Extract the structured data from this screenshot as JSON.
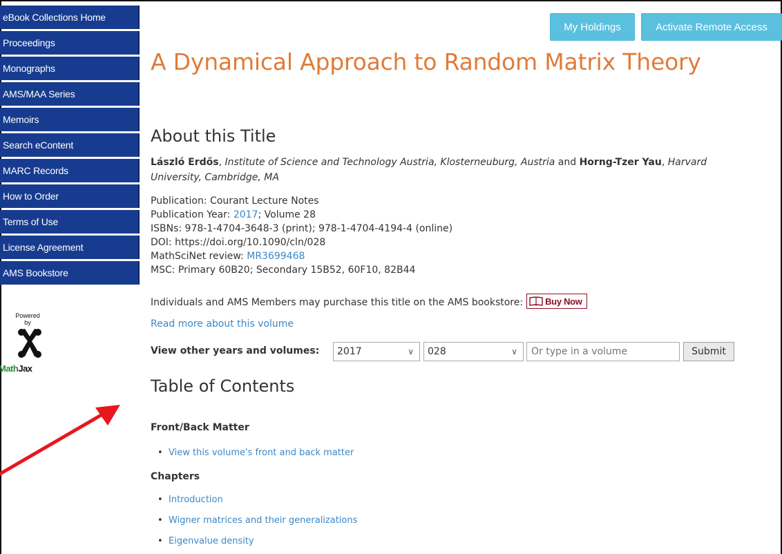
{
  "sidebar": {
    "items": [
      {
        "label": "eBook Collections Home"
      },
      {
        "label": "Proceedings"
      },
      {
        "label": "Monographs"
      },
      {
        "label": "AMS/MAA Series"
      },
      {
        "label": "Memoirs"
      },
      {
        "label": "Search eContent"
      },
      {
        "label": "MARC Records"
      },
      {
        "label": "How to Order"
      },
      {
        "label": "Terms of Use"
      },
      {
        "label": "License Agreement"
      },
      {
        "label": "AMS Bookstore"
      }
    ],
    "powered_by": "Powered\nby",
    "mathjax_math": "Math",
    "mathjax_jax": "Jax"
  },
  "header": {
    "my_holdings": "My Holdings",
    "activate_remote_access": "Activate Remote Access"
  },
  "book": {
    "title": "A Dynamical Approach to Random Matrix Theory",
    "about_heading": "About this Title",
    "author1": "László Erdős",
    "author1_affil": "Institute of Science and Technology Austria, Klosterneuburg, Austria",
    "and": " and ",
    "author2": "Horng-Tzer Yau",
    "author2_affil_line1": "Harvard",
    "author2_affil_line2": "University, Cambridge, MA",
    "publication": "Publication: Courant Lecture Notes",
    "pub_year_prefix": "Publication Year: ",
    "pub_year": "2017",
    "pub_volume": "; Volume 28",
    "isbns": "ISBNs: 978-1-4704-3648-3 (print); 978-1-4704-4194-4 (online)",
    "doi": "DOI: https://doi.org/10.1090/cln/028",
    "mathscinet_prefix": "MathSciNet review: ",
    "mathscinet": "MR3699468",
    "msc": "MSC: Primary 60B20; Secondary 15B52, 60F10, 82B44",
    "purchase_text": "Individuals and AMS Members may purchase this title on the AMS bookstore:",
    "buy_now": "Buy Now",
    "read_more": "Read more about this volume"
  },
  "volume_selector": {
    "label": "View other years and volumes:",
    "year": "2017",
    "volume": "028",
    "placeholder": "Or type in a volume",
    "submit": "Submit"
  },
  "toc": {
    "heading": "Table of Contents",
    "front_back_heading": "Front/Back Matter",
    "front_back_items": [
      "View this volume's front and back matter"
    ],
    "chapters_heading": "Chapters",
    "chapters": [
      "Introduction",
      "Wigner matrices and their generalizations",
      "Eigenvalue density"
    ]
  },
  "colors": {
    "sidebar_bg": "#173c8f",
    "title": "#e07b39",
    "link": "#3a87c8",
    "button": "#5bc0de",
    "annotation_arrow": "#e8171e"
  }
}
